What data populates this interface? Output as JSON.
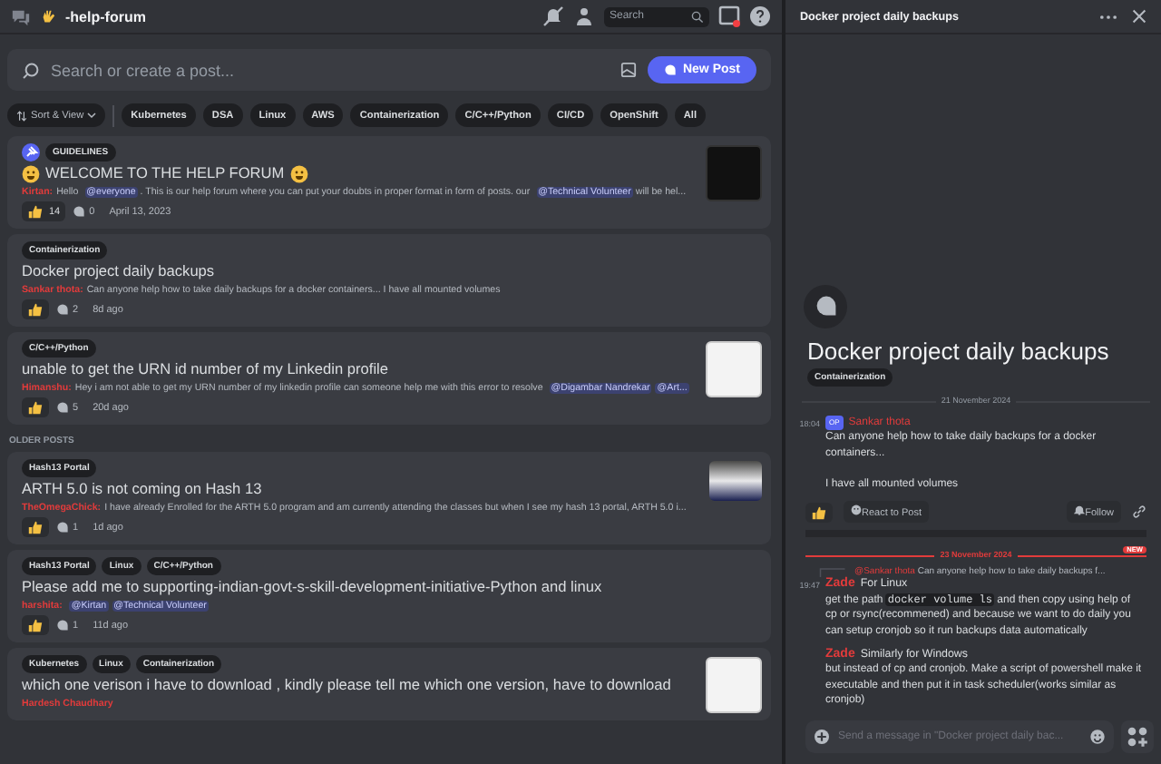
{
  "header": {
    "channel": "-help-forum",
    "search_placeholder": "Search"
  },
  "toolbar": {
    "search_placeholder": "Search or create a post...",
    "new_post": "New Post",
    "sort": "Sort & View",
    "tags": [
      "Kubernetes",
      "DSA",
      "Linux",
      "AWS",
      "Containerization",
      "C/C++/Python",
      "CI/CD",
      "OpenShift",
      "All"
    ]
  },
  "posts": [
    {
      "pinned": true,
      "tags": [
        "GUIDELINES"
      ],
      "title": "WELCOME TO THE HELP FORUM",
      "title_emoji": true,
      "author": "Kirtan:",
      "message": [
        {
          "kind": "plain",
          "text": "Hello "
        },
        {
          "kind": "mention",
          "text": "@everyone"
        },
        {
          "kind": "plain",
          "text": " . This is our help forum where you can put your doubts in proper format in form of posts. our "
        },
        {
          "kind": "mention",
          "text": "@Technical Volunteer"
        },
        {
          "kind": "plain",
          "text": " will be hel..."
        }
      ],
      "likes": "14",
      "comments": "0",
      "time": "April 13, 2023",
      "thumbnail": {
        "kind": "poster"
      }
    },
    {
      "pinned": false,
      "tags": [
        "Containerization"
      ],
      "title": "Docker project daily backups",
      "title_emoji": false,
      "author": "Sankar thota:",
      "message": [
        {
          "kind": "plain",
          "text": "Can anyone help how to take daily backups for a docker containers... I have all mounted volumes"
        }
      ],
      "comments": "2",
      "time": "8d ago"
    },
    {
      "pinned": false,
      "tags": [
        "C/C++/Python"
      ],
      "title": "unable to get the URN id number of my Linkedin profile",
      "title_emoji": false,
      "author": "Himanshu:",
      "message": [
        {
          "kind": "plain",
          "text": "Hey i am not able to get my URN number of my linkedin profile can someone help me with this error to resolve "
        },
        {
          "kind": "mention",
          "text": "@Digambar Nandrekar"
        },
        {
          "kind": "mention",
          "text": "@Art..."
        }
      ],
      "comments": "5",
      "time": "20d ago",
      "thumbnail": {
        "kind": "document"
      }
    }
  ],
  "older": {
    "label": "OLDER POSTS",
    "posts": [
      {
        "pinned": false,
        "tags": [
          "Hash13 Portal"
        ],
        "title": "ARTH 5.0 is not coming on Hash 13",
        "title_emoji": false,
        "author": "TheOmegaChick:",
        "message": [
          {
            "kind": "plain",
            "text": "I have already Enrolled for the ARTH 5.0 program and am currently attending the classes but when I see my hash 13 portal, ARTH 5.0 i..."
          }
        ],
        "comments": "1",
        "time": "1d ago",
        "thumbnail": {
          "kind": "screen"
        }
      },
      {
        "pinned": false,
        "tags": [
          "Hash13 Portal",
          "Linux",
          "C/C++/Python"
        ],
        "title": "Please add me to supporting-indian-govt-s-skill-development-initiative-Python and linux",
        "title_emoji": false,
        "author": "harshita:",
        "message": [
          {
            "kind": "mention",
            "text": "@Kirtan"
          },
          {
            "kind": "mention",
            "text": "@Technical Volunteer"
          }
        ],
        "comments": "1",
        "time": "11d ago"
      },
      {
        "pinned": false,
        "tags": [
          "Kubernetes",
          "Linux",
          "Containerization"
        ],
        "title": "which one verison i have to download , kindly please tell me which one version, have to download",
        "title_emoji": false,
        "author": "Hardesh Chaudhary",
        "thumbnail": {
          "kind": "document"
        }
      }
    ]
  },
  "thread": {
    "header_title": "Docker project daily backups",
    "title": "Docker project daily backups",
    "tag": "Containerization",
    "date": "21 November 2024",
    "post": {
      "time": "18:04",
      "badge": "OP",
      "author": "Sankar thota",
      "lines": [
        "Can anyone help how to take daily backups for a docker containers...",
        "I have all mounted volumes"
      ]
    },
    "react": "React to Post",
    "follow": "Follow",
    "new_date": "23 November 2024",
    "new_badge": "NEW",
    "reply_preview": {
      "author": "@Sankar thota",
      "text": "Can anyone help how to take daily backups f..."
    },
    "messages": [
      {
        "time": "19:47",
        "author": "Zade",
        "first": "For Linux",
        "body": [
          {
            "kind": "plain",
            "text": "get the path "
          },
          {
            "kind": "code",
            "text": "docker volume ls"
          },
          {
            "kind": "plain",
            "text": " and then copy using help of cp or rsync(recommened) and because we want to do daily you can setup cronjob so it run backups data automatically"
          }
        ]
      },
      {
        "author": "Zade",
        "first": "Similarly for Windows",
        "body": [
          {
            "kind": "plain",
            "text": "but instead of cp and cronjob. Make a script of powershell make it executable and then put it in task scheduler(works similar as cronjob)"
          }
        ]
      }
    ],
    "input_placeholder": "Send a message in \"Docker project daily bac..."
  }
}
